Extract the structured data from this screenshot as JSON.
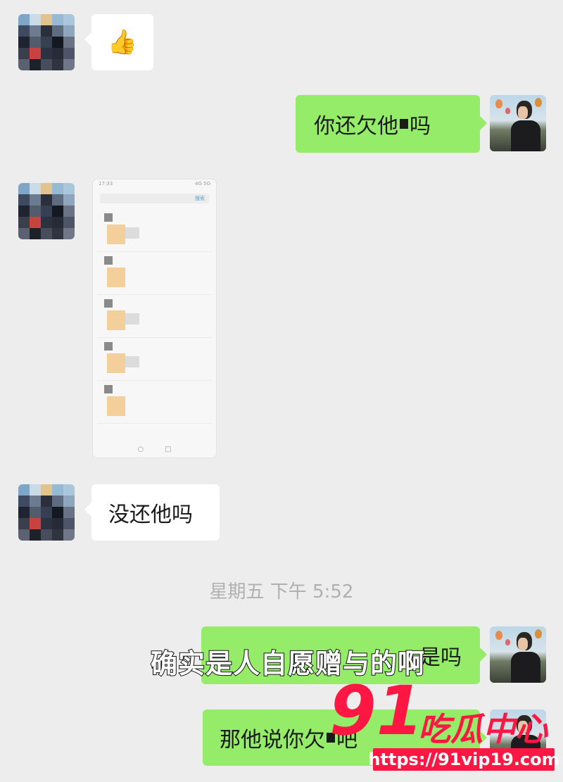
{
  "messages": [
    {
      "side": "left",
      "text": "👍"
    },
    {
      "side": "right",
      "text_before": "你还欠他",
      "text_after": "吗"
    },
    {
      "side": "left",
      "kind": "image"
    },
    {
      "side": "left",
      "text": "没还他吗"
    },
    {
      "side": "right",
      "text": "是吗"
    },
    {
      "side": "right",
      "text_before": "那他说你欠",
      "text_after": "吧"
    }
  ],
  "timestamp": "星期五 下午 5:52",
  "subtitle": "确实是人自愿赠与的啊",
  "screenshot": {
    "status_time": "17:33",
    "status_right": "4G 5G",
    "search_hint": "搜索",
    "nav_left": "○",
    "nav_right": "□"
  },
  "watermark": {
    "number": "91",
    "brand": "吃瓜中心",
    "url": "https://91vip19.com"
  },
  "colors": {
    "background": "#ededed",
    "self_bubble": "#95ec69",
    "other_bubble": "#ffffff",
    "watermark": "#ff1744"
  }
}
